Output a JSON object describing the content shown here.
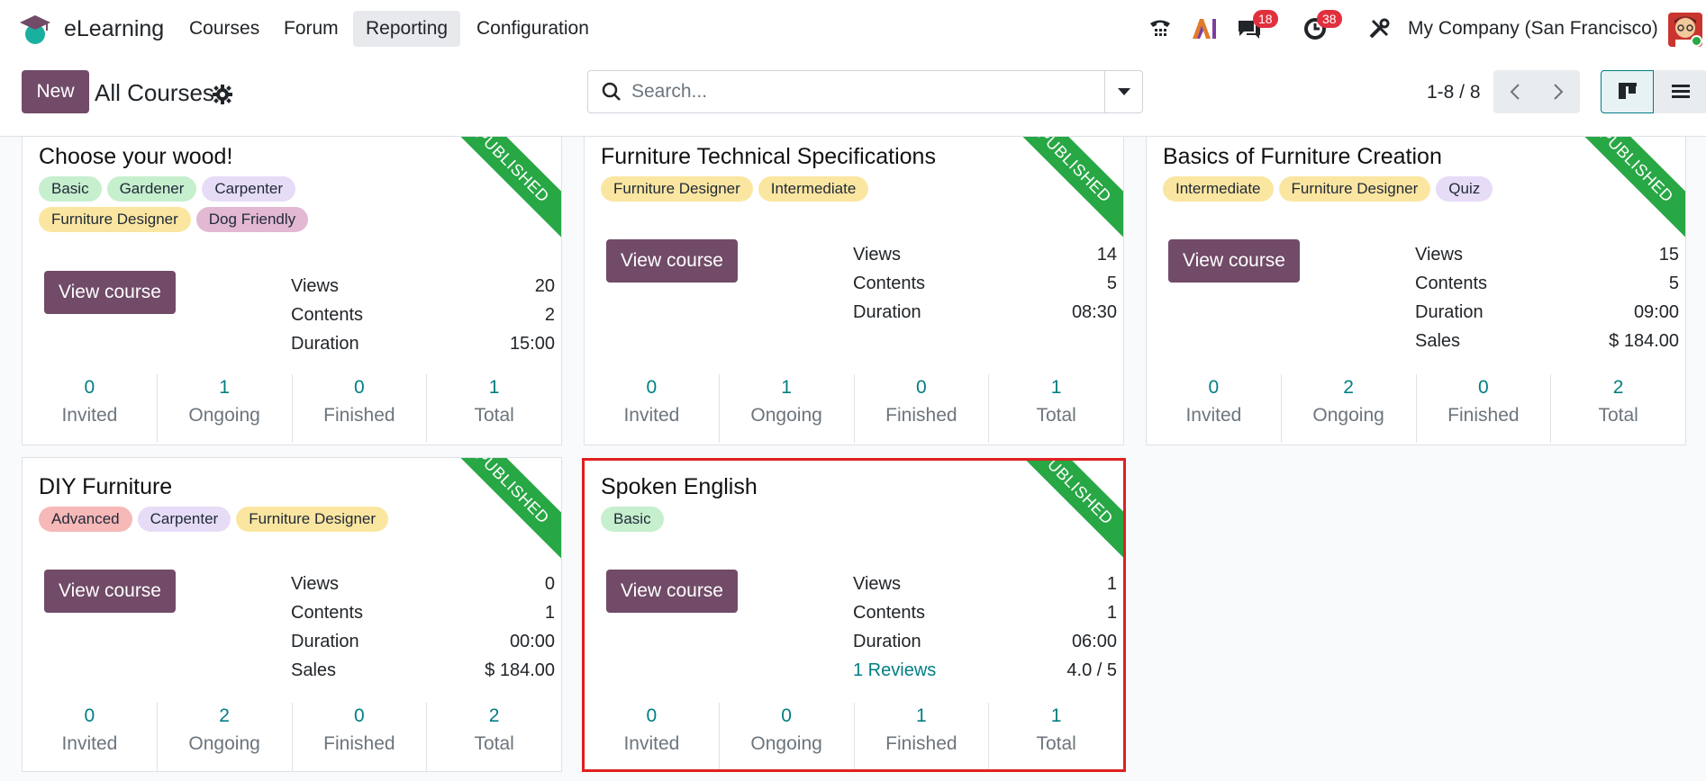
{
  "nav": {
    "app_name": "eLearning",
    "menu": [
      "Courses",
      "Forum",
      "Reporting",
      "Configuration"
    ],
    "active_menu": "Reporting",
    "messages_badge": "18",
    "activities_badge": "38",
    "company": "My Company (San Francisco)"
  },
  "control": {
    "new_label": "New",
    "breadcrumb": "All Courses",
    "search_placeholder": "Search...",
    "pager": "1-8 / 8"
  },
  "courses": [
    {
      "title": "Choose your wood!",
      "tags": [
        {
          "label": "Basic",
          "color": "#c6efce"
        },
        {
          "label": "Gardener",
          "color": "#c6efce"
        },
        {
          "label": "Carpenter",
          "color": "#e6dcf7"
        },
        {
          "label": "Furniture Designer",
          "color": "#fbe6a1"
        },
        {
          "label": "Dog Friendly",
          "color": "#e2b8d3"
        }
      ],
      "ribbon": "PUBLISHED",
      "button": "View course",
      "stats": [
        {
          "label": "Views",
          "value": "20"
        },
        {
          "label": "Contents",
          "value": "2"
        },
        {
          "label": "Duration",
          "value": "15:00"
        }
      ],
      "counters": [
        {
          "num": "0",
          "label": "Invited"
        },
        {
          "num": "1",
          "label": "Ongoing"
        },
        {
          "num": "0",
          "label": "Finished"
        },
        {
          "num": "1",
          "label": "Total"
        }
      ]
    },
    {
      "title": "Furniture Technical Specifications",
      "tags": [
        {
          "label": "Furniture Designer",
          "color": "#fbe6a1"
        },
        {
          "label": "Intermediate",
          "color": "#fbe6a1"
        }
      ],
      "ribbon": "PUBLISHED",
      "button": "View course",
      "stats": [
        {
          "label": "Views",
          "value": "14"
        },
        {
          "label": "Contents",
          "value": "5"
        },
        {
          "label": "Duration",
          "value": "08:30"
        }
      ],
      "counters": [
        {
          "num": "0",
          "label": "Invited"
        },
        {
          "num": "1",
          "label": "Ongoing"
        },
        {
          "num": "0",
          "label": "Finished"
        },
        {
          "num": "1",
          "label": "Total"
        }
      ]
    },
    {
      "title": "Basics of Furniture Creation",
      "tags": [
        {
          "label": "Intermediate",
          "color": "#fbe6a1"
        },
        {
          "label": "Furniture Designer",
          "color": "#fbe6a1"
        },
        {
          "label": "Quiz",
          "color": "#e6dcf7"
        }
      ],
      "ribbon": "PUBLISHED",
      "button": "View course",
      "stats": [
        {
          "label": "Views",
          "value": "15"
        },
        {
          "label": "Contents",
          "value": "5"
        },
        {
          "label": "Duration",
          "value": "09:00"
        },
        {
          "label": "Sales",
          "value": "$ 184.00"
        }
      ],
      "counters": [
        {
          "num": "0",
          "label": "Invited"
        },
        {
          "num": "2",
          "label": "Ongoing"
        },
        {
          "num": "0",
          "label": "Finished"
        },
        {
          "num": "2",
          "label": "Total"
        }
      ]
    },
    {
      "title": "DIY Furniture",
      "tags": [
        {
          "label": "Advanced",
          "color": "#f7b8b8"
        },
        {
          "label": "Carpenter",
          "color": "#e6dcf7"
        },
        {
          "label": "Furniture Designer",
          "color": "#fbe6a1"
        }
      ],
      "ribbon": "PUBLISHED",
      "button": "View course",
      "stats": [
        {
          "label": "Views",
          "value": "0"
        },
        {
          "label": "Contents",
          "value": "1"
        },
        {
          "label": "Duration",
          "value": "00:00"
        },
        {
          "label": "Sales",
          "value": "$ 184.00"
        }
      ],
      "counters": [
        {
          "num": "0",
          "label": "Invited"
        },
        {
          "num": "2",
          "label": "Ongoing"
        },
        {
          "num": "0",
          "label": "Finished"
        },
        {
          "num": "2",
          "label": "Total"
        }
      ]
    },
    {
      "title": "Spoken English",
      "tags": [
        {
          "label": "Basic",
          "color": "#c6efce"
        }
      ],
      "ribbon": "PUBLISHED",
      "button": "View course",
      "stats": [
        {
          "label": "Views",
          "value": "1"
        },
        {
          "label": "Contents",
          "value": "1"
        },
        {
          "label": "Duration",
          "value": "06:00"
        },
        {
          "label": "1 Reviews",
          "value": "4.0 / 5",
          "link": true
        }
      ],
      "counters": [
        {
          "num": "0",
          "label": "Invited"
        },
        {
          "num": "0",
          "label": "Ongoing"
        },
        {
          "num": "1",
          "label": "Finished"
        },
        {
          "num": "1",
          "label": "Total"
        }
      ]
    }
  ]
}
